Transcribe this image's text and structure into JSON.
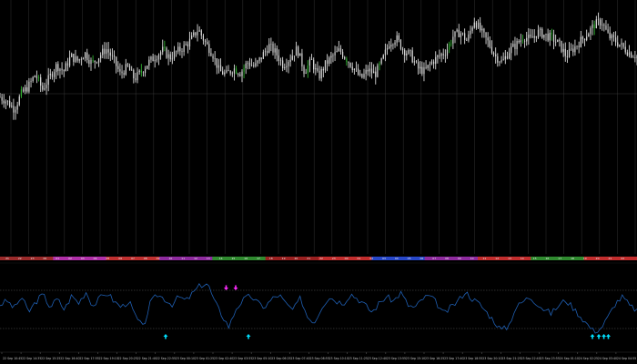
{
  "chart": {
    "background": "#000000",
    "candle_color": "#d9d9d9",
    "highlight_candle_color": "#2fae2f",
    "grid_color": "#2a2a2a",
    "oscillator_line_color": "#1f5fb3",
    "signal_up_color": "#00e0ff",
    "signal_down_color": "#ff2bff",
    "price_series_visual_levels": [
      0.43,
      0.4,
      0.35,
      0.45,
      0.5,
      0.58,
      0.48,
      0.56,
      0.64,
      0.6,
      0.7,
      0.67,
      0.72,
      0.65,
      0.7,
      0.75,
      0.68,
      0.58,
      0.63,
      0.55,
      0.6,
      0.66,
      0.7,
      0.74,
      0.69,
      0.73,
      0.76,
      0.81,
      0.88,
      0.79,
      0.72,
      0.6,
      0.58,
      0.62,
      0.59,
      0.66,
      0.63,
      0.7,
      0.77,
      0.72,
      0.64,
      0.69,
      0.75,
      0.6,
      0.67,
      0.56,
      0.65,
      0.7,
      0.74,
      0.68,
      0.62,
      0.55,
      0.61,
      0.58,
      0.67,
      0.79,
      0.82,
      0.74,
      0.71,
      0.62,
      0.6,
      0.66,
      0.7,
      0.73,
      0.83,
      0.86,
      0.8,
      0.94,
      0.86,
      0.79,
      0.7,
      0.66,
      0.74,
      0.78,
      0.83,
      0.81,
      0.86,
      0.84,
      0.82,
      0.78,
      0.7,
      0.75,
      0.8,
      0.85,
      0.91,
      0.93,
      0.83,
      0.8,
      0.76,
      0.72,
      0.7
    ],
    "oscillator_visual_levels": [
      0.55,
      0.62,
      0.48,
      0.7,
      0.4,
      0.6,
      0.75,
      0.5,
      0.66,
      0.45,
      0.72,
      0.58,
      0.8,
      0.52,
      0.68,
      0.78,
      0.6,
      0.5,
      0.62,
      0.3,
      0.1,
      0.58,
      0.74,
      0.66,
      0.55,
      0.7,
      0.62,
      0.78,
      0.92,
      0.96,
      0.6,
      0.35,
      0.12,
      0.48,
      0.64,
      0.72,
      0.58,
      0.5,
      0.66,
      0.74,
      0.55,
      0.44,
      0.68,
      0.3,
      0.22,
      0.52,
      0.7,
      0.62,
      0.58,
      0.76,
      0.66,
      0.54,
      0.4,
      0.58,
      0.7,
      0.62,
      0.78,
      0.54,
      0.48,
      0.66,
      0.72,
      0.58,
      0.36,
      0.5,
      0.62,
      0.8,
      0.66,
      0.56,
      0.4,
      0.24,
      0.06,
      0.12,
      0.48,
      0.6,
      0.7,
      0.58,
      0.46,
      0.38,
      0.52,
      0.64,
      0.5,
      0.34,
      0.18,
      0.02,
      0.1,
      0.32,
      0.58,
      0.7,
      0.52,
      0.44
    ],
    "oscillator_up_signal_positions": [
      0.26,
      0.39,
      0.93,
      0.94,
      0.948,
      0.955
    ],
    "oscillator_down_signal_positions": [
      0.355,
      0.37
    ],
    "session_bar_colors": [
      "#9a2a2a",
      "#b02fa8",
      "#c03030",
      "#8e2a9e",
      "#2f8a2f",
      "#9a2020",
      "#c22d2d",
      "#2747c9",
      "#8e2a9e",
      "#c22d2d",
      "#2f8a2f",
      "#c22d2d"
    ],
    "session_bar_labels": [
      "21",
      "22",
      "23",
      "00",
      "01",
      "02",
      "03",
      "04",
      "05",
      "06",
      "07",
      "08",
      "09",
      "10",
      "11",
      "12",
      "13",
      "14",
      "15",
      "16",
      "17",
      "18",
      "19",
      "20",
      "21",
      "22",
      "23",
      "00",
      "01",
      "02",
      "03",
      "04",
      "05",
      "06",
      "07",
      "08",
      "09",
      "10",
      "11",
      "12",
      "13",
      "14",
      "15",
      "16",
      "17",
      "18",
      "19",
      "20",
      "21",
      "22"
    ],
    "time_axis_labels": [
      "22 Sep 10:45",
      "22 Sep 14:35",
      "22 Sep 15:25",
      "22 Sep 16:40",
      "22 Sep 17:55",
      "22 Sep 19:10",
      "22 Sep 20:25",
      "22 Sep 21:40",
      "22 Sep 22:55",
      "23 Sep 00:10",
      "23 Sep 01:25",
      "23 Sep 02:40",
      "23 Sep 03:55",
      "23 Sep 05:10",
      "23 Sep 06:25",
      "23 Sep 07:40",
      "23 Sep 08:55",
      "23 Sep 10:10",
      "23 Sep 11:25",
      "23 Sep 12:40",
      "23 Sep 13:55",
      "23 Sep 15:10",
      "23 Sep 16:25",
      "23 Sep 17:40",
      "23 Sep 18:55",
      "23 Sep 20:10",
      "23 Sep 21:25",
      "23 Sep 22:40",
      "23 Sep 23:55",
      "24 Sep 01:10",
      "24 Sep 02:25",
      "24 Sep 03:40",
      "24 Sep 04:55"
    ]
  }
}
